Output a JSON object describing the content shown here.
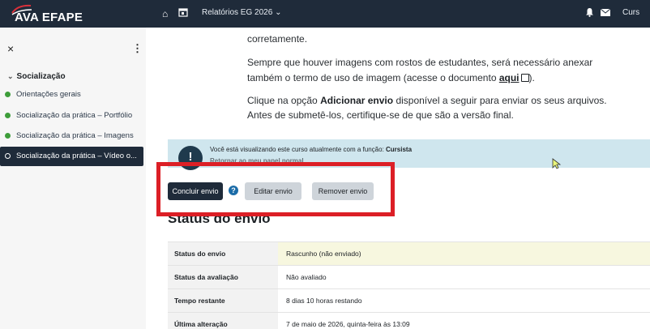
{
  "header": {
    "brand": "AVA EFAPE",
    "home_icon": "home-icon",
    "calendar_icon": "calendar-icon",
    "reports_menu": "Relatórios EG 2026",
    "bell_icon": "bell-icon",
    "mail_icon": "mail-icon",
    "user_label": "Curs"
  },
  "sidebar": {
    "close_icon": "×",
    "more_icon": "⋮",
    "section": "Socialização",
    "items": [
      {
        "label": "Orientações gerais",
        "state": "complete"
      },
      {
        "label": "Socialização da prática – Portfólio",
        "state": "complete"
      },
      {
        "label": "Socialização da prática – Imagens",
        "state": "complete"
      },
      {
        "label": "Socialização da prática – Vídeo o...",
        "state": "current"
      }
    ]
  },
  "main": {
    "line1": "corretamente.",
    "para1_line1": "Sempre que houver imagens com rostos de estudantes, será necessário anexar",
    "para1_line2_prefix": "também o termo de uso de imagem (acesse o documento ",
    "para1_link": "aqui",
    "para1_line2_suffix": ").",
    "para2_line1_prefix": "Clique na opção ",
    "para2_bold": "Adicionar envio",
    "para2_line1_suffix": " disponível a seguir para enviar os seus arquivos.",
    "para2_line2": "Antes de submetê-los, certifique-se de que são a versão final."
  },
  "banner": {
    "text_prefix": "Você está visualizando este curso atualmente com a função: ",
    "role": "Cursista",
    "sub": "Retornar ao meu papel normal"
  },
  "actions": {
    "submit": "Concluir envio",
    "edit": "Editar envio",
    "remove": "Remover envio"
  },
  "status": {
    "heading": "Status do envio",
    "rows": [
      {
        "key": "Status do envio",
        "value": "Rascunho (não enviado)"
      },
      {
        "key": "Status da avaliação",
        "value": "Não avaliado"
      },
      {
        "key": "Tempo restante",
        "value": "8 dias 10 horas restando"
      },
      {
        "key": "Última alteração",
        "value": "7 de maio de 2026, quinta-feira às 13:09"
      }
    ]
  },
  "colors": {
    "navbar": "#1f2b3a",
    "highlight": "#dc1f26",
    "banner": "#cfe6ee",
    "complete_dot": "#3d9d3a"
  }
}
